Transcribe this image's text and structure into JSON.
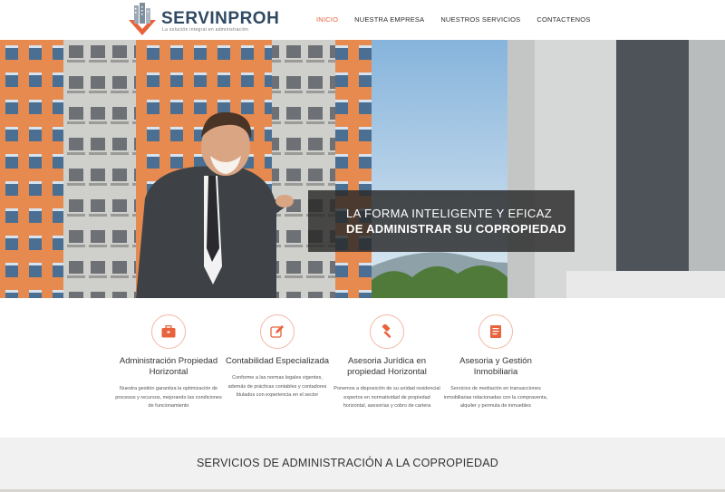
{
  "header": {
    "logo_name": "SERVINPROH",
    "logo_tagline": "La solución integral en administración",
    "nav": [
      {
        "label": "INICIO",
        "active": true
      },
      {
        "label": "NUESTRA EMPRESA",
        "active": false
      },
      {
        "label": "NUESTROS SERVICIOS",
        "active": false
      },
      {
        "label": "CONTACTENOS",
        "active": false
      }
    ]
  },
  "hero": {
    "line1": "LA FORMA INTELIGENTE Y EFICAZ",
    "line2": "DE ADMINISTRAR SU COPROPIEDAD"
  },
  "services": [
    {
      "icon": "briefcase-icon",
      "title": "Administración Propiedad Horizontal",
      "description": "Nuestra gestión garantiza la optimización de procesos y recursos, mejorando las condiciones de funcionamiento"
    },
    {
      "icon": "edit-icon",
      "title": "Contabilidad Especializada",
      "description": "Conforme a las normas legales vigentes, además de prácticas contables y contadores titulados con experiencia en el sector"
    },
    {
      "icon": "gavel-icon",
      "title": "Asesoria Jurídica en propiedad Horizontal",
      "description": "Ponemos a disposición de su unidad residencial expertos en normatividad de propiedad horizontal, asesorías y cobro de cartera"
    },
    {
      "icon": "document-icon",
      "title": "Asesoria y Gestión Inmobiliaria",
      "description": "Servicios de mediación en transacciones inmobiliarias relacionadas con la compraventa, alquiler y permuta de inmuebles"
    }
  ],
  "section": {
    "title": "SERVICIOS DE ADMINISTRACIÓN A LA COPROPIEDAD"
  },
  "colors": {
    "accent": "#e8623b",
    "brand": "#2f4a63"
  }
}
